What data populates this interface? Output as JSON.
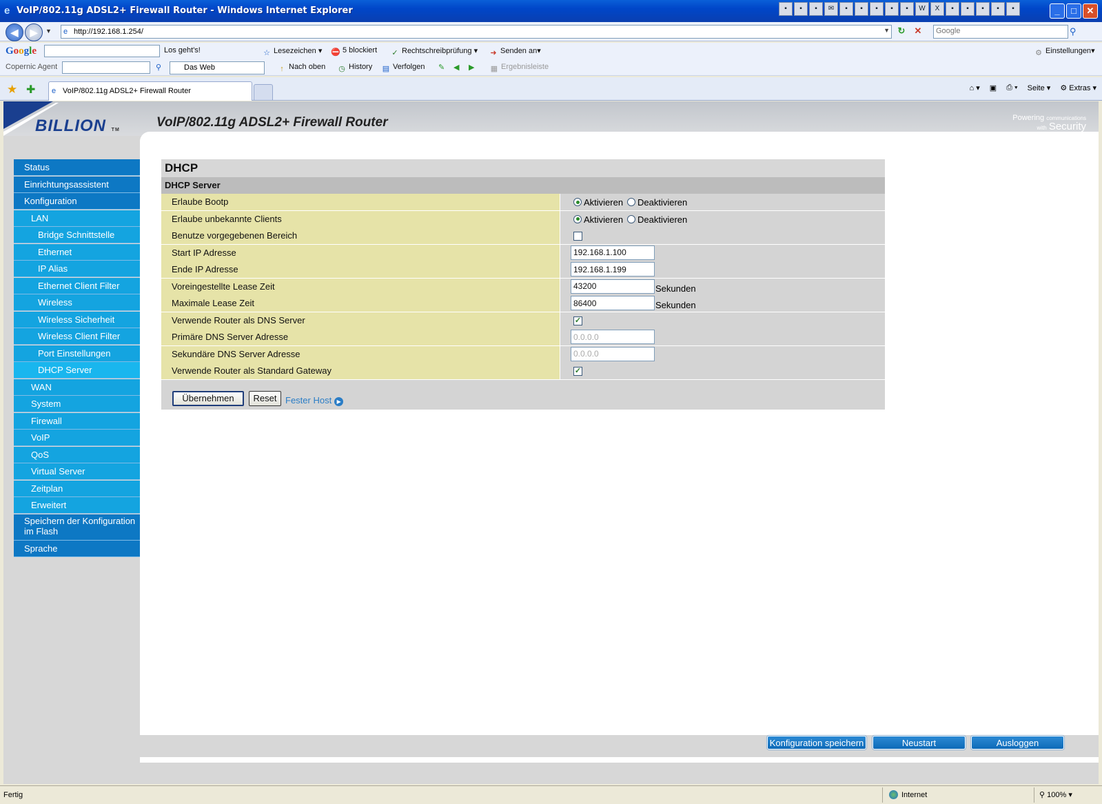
{
  "window": {
    "title": "VoIP/802.11g ADSL2+ Firewall Router - Windows Internet Explorer",
    "minimize": "_",
    "maximize": "□",
    "close": "✕"
  },
  "address_bar": {
    "url": "http://192.168.1.254/",
    "search_placeholder": "Google"
  },
  "google_toolbar": {
    "logo": "Google",
    "go_label": "Los geht's!",
    "bookmarks": "Lesezeichen",
    "blocked": "5 blockiert",
    "spellcheck": "Rechtschreibprüfung",
    "send_to": "Senden an",
    "settings": "Einstellungen"
  },
  "copernic_toolbar": {
    "label": "Copernic Agent",
    "scope": "Das Web",
    "top": "Nach oben",
    "history": "History",
    "track": "Verfolgen",
    "results": "Ergebnisleiste"
  },
  "tabs": {
    "active": "VoIP/802.11g ADSL2+ Firewall Router"
  },
  "command_bar": {
    "page": "Seite",
    "extras": "Extras"
  },
  "header": {
    "logo": "BILLION",
    "logo_tm": "TM",
    "router_title": "VoIP/802.11g ADSL2+ Firewall Router",
    "powering_line1": "Powering",
    "powering_line1b": "communications",
    "powering_line2": "with",
    "powering_line2b": "Security"
  },
  "sidebar": {
    "items": [
      {
        "label": "Status",
        "level": 0
      },
      {
        "label": "Einrichtungsassistent",
        "level": 0
      },
      {
        "label": "Konfiguration",
        "level": 0
      },
      {
        "label": "LAN",
        "level": 1
      },
      {
        "label": "Bridge Schnittstelle",
        "level": 2
      },
      {
        "label": "Ethernet",
        "level": 2
      },
      {
        "label": "IP Alias",
        "level": 2
      },
      {
        "label": "Ethernet Client Filter",
        "level": 2
      },
      {
        "label": "Wireless",
        "level": 2
      },
      {
        "label": "Wireless Sicherheit",
        "level": 2
      },
      {
        "label": "Wireless Client Filter",
        "level": 2
      },
      {
        "label": "Port Einstellungen",
        "level": 2
      },
      {
        "label": "DHCP Server",
        "level": 2
      },
      {
        "label": "WAN",
        "level": 1
      },
      {
        "label": "System",
        "level": 1
      },
      {
        "label": "Firewall",
        "level": 1
      },
      {
        "label": "VoIP",
        "level": 1
      },
      {
        "label": "QoS",
        "level": 1
      },
      {
        "label": "Virtual Server",
        "level": 1
      },
      {
        "label": "Zeitplan",
        "level": 1
      },
      {
        "label": "Erweitert",
        "level": 1
      },
      {
        "label": "Speichern der Konfiguration im Flash",
        "level": 0
      },
      {
        "label": "Sprache",
        "level": 0
      }
    ]
  },
  "panel": {
    "title": "DHCP",
    "subtitle": "DHCP Server",
    "rows": {
      "bootp": {
        "label": "Erlaube Bootp",
        "on": "Aktivieren",
        "off": "Deaktivieren",
        "selected": "on"
      },
      "unknown_clients": {
        "label": "Erlaube unbekannte Clients",
        "on": "Aktivieren",
        "off": "Deaktivieren",
        "selected": "on"
      },
      "range": {
        "label": "Benutze vorgegebenen Bereich",
        "checked": false
      },
      "start_ip": {
        "label": "Start IP Adresse",
        "value": "192.168.1.100"
      },
      "end_ip": {
        "label": "Ende IP Adresse",
        "value": "192.168.1.199"
      },
      "default_lease": {
        "label": "Voreingestellte Lease Zeit",
        "value": "43200",
        "unit": "Sekunden"
      },
      "max_lease": {
        "label": "Maximale Lease Zeit",
        "value": "86400",
        "unit": "Sekunden"
      },
      "router_dns": {
        "label": "Verwende Router als DNS Server",
        "checked": true
      },
      "primary_dns": {
        "label": "Primäre DNS Server Adresse",
        "value": "0.0.0.0"
      },
      "secondary_dns": {
        "label": "Sekundäre DNS Server Adresse",
        "value": "0.0.0.0"
      },
      "router_gateway": {
        "label": "Verwende Router als Standard Gateway",
        "checked": true
      }
    },
    "apply": "Übernehmen",
    "reset": "Reset",
    "fixed_host": "Fester Host"
  },
  "bottom_buttons": {
    "save": "Konfiguration speichern",
    "reboot": "Neustart",
    "logout": "Ausloggen"
  },
  "status_bar": {
    "status": "Fertig",
    "zone": "Internet",
    "zoom": "100%"
  },
  "colors": {
    "nav_dark": "#0d78c4",
    "nav_light": "#14a4e0",
    "label_bg": "#e6e3a8",
    "value_bg": "#d4d4d4"
  }
}
